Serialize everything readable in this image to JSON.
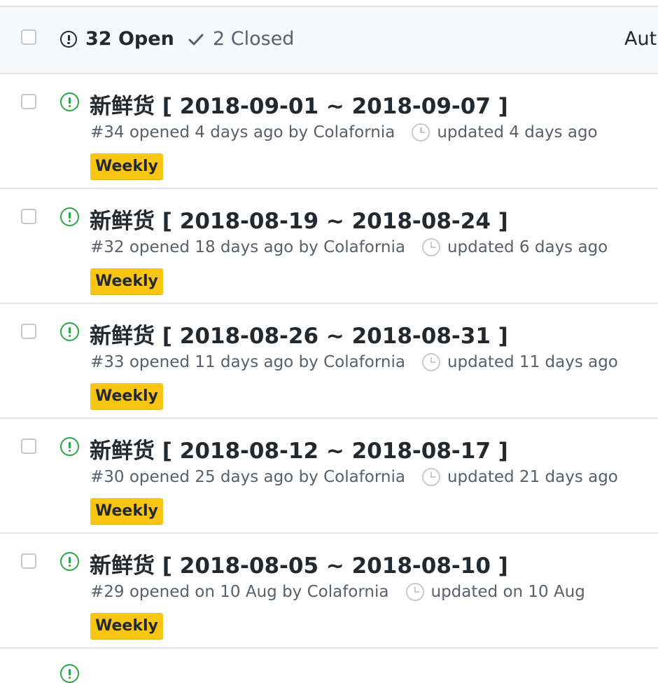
{
  "header": {
    "open_label": "32 Open",
    "closed_label": "2 Closed",
    "author_filter": "Author"
  },
  "colors": {
    "open_icon": "#28a745",
    "label_weekly": "#f9c513"
  },
  "issues": [
    {
      "title": "新鲜货 [ 2018-09-01 ~ 2018-09-07 ]",
      "meta": "#34 opened 4 days ago by Colafornia",
      "updated": "updated 4 days ago",
      "label": "Weekly"
    },
    {
      "title": "新鲜货 [ 2018-08-19 ~ 2018-08-24 ]",
      "meta": "#32 opened 18 days ago by Colafornia",
      "updated": "updated 6 days ago",
      "label": "Weekly"
    },
    {
      "title": "新鲜货 [ 2018-08-26 ~ 2018-08-31 ]",
      "meta": "#33 opened 11 days ago by Colafornia",
      "updated": "updated 11 days ago",
      "label": "Weekly"
    },
    {
      "title": "新鲜货 [ 2018-08-12 ~ 2018-08-17 ]",
      "meta": "#30 opened 25 days ago by Colafornia",
      "updated": "updated 21 days ago",
      "label": "Weekly"
    },
    {
      "title": "新鲜货 [ 2018-08-05 ~ 2018-08-10 ]",
      "meta": "#29 opened on 10 Aug by Colafornia",
      "updated": "updated on 10 Aug",
      "label": "Weekly"
    }
  ]
}
